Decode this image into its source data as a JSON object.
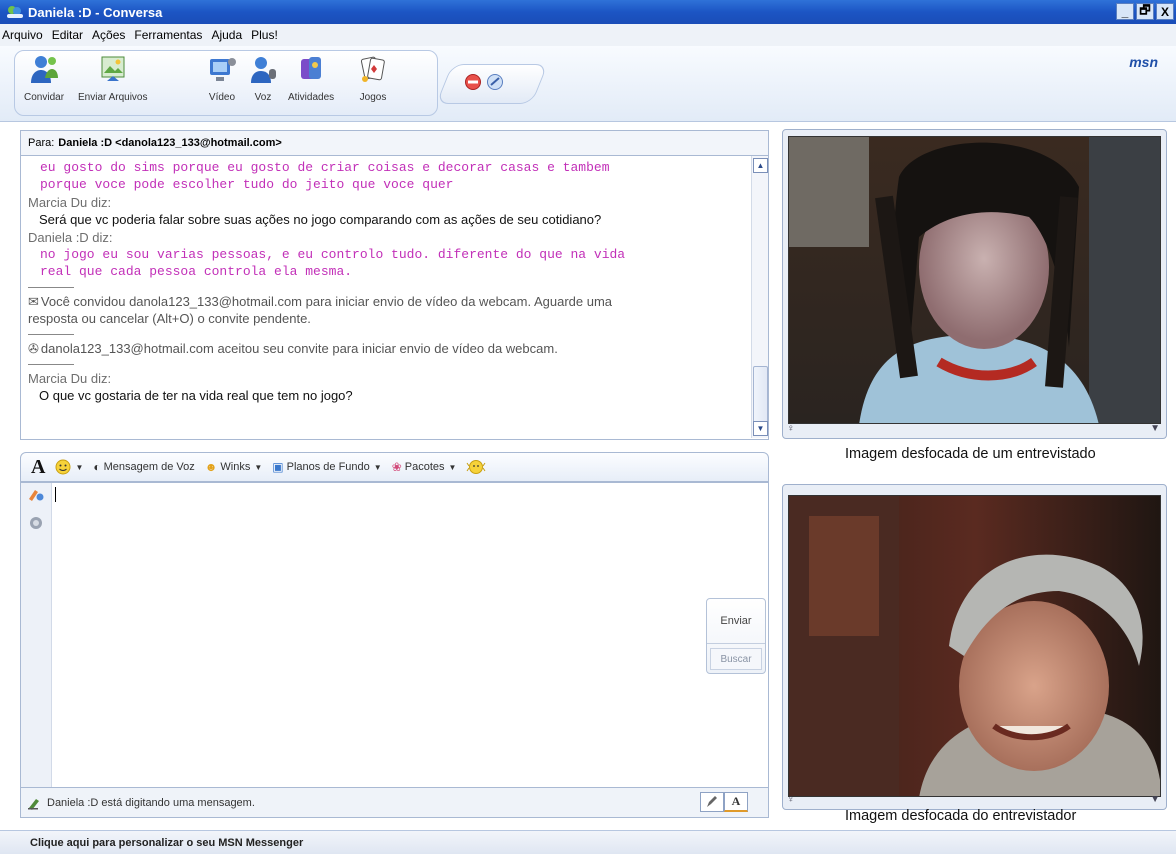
{
  "window": {
    "title": "Daniela :D - Conversa",
    "controls": [
      "_",
      "🗗",
      "X"
    ]
  },
  "menu": [
    "Arquivo",
    "Editar",
    "Ações",
    "Ferramentas",
    "Ajuda",
    "Plus!"
  ],
  "toolbar": {
    "buttons": [
      {
        "label": "Convidar",
        "icon": "invite-contact-icon"
      },
      {
        "label": "Enviar Arquivos",
        "icon": "send-files-icon"
      },
      {
        "label": "Vídeo",
        "icon": "video-camera-icon"
      },
      {
        "label": "Voz",
        "icon": "voice-icon"
      },
      {
        "label": "Atividades",
        "icon": "activities-icon"
      },
      {
        "label": "Jogos",
        "icon": "games-icon"
      }
    ],
    "extra_icons": [
      "block-icon",
      "display-picture-icon"
    ],
    "brand": "msn"
  },
  "conversation": {
    "to_label": "Para:",
    "to_contact": "Daniela :D <danola123_133@hotmail.com>",
    "messages": {
      "m1_line1": "eu gosto do sims porque eu gosto de criar coisas e decorar casas e tambem",
      "m1_line2": "porque voce pode escolher tudo do jeito que voce quer",
      "m2_speaker": "Marcia Du diz:",
      "m2_text": "Será que vc poderia falar sobre suas ações no jogo comparando com as ações de seu cotidiano?",
      "m3_speaker": "Daniela :D diz:",
      "m3_line1": "no jogo eu sou varias pessoas, e eu controlo tudo. diferente do que na vida",
      "m3_line2": "real que cada pessoa controla ela mesma.",
      "sys1_line1": "Você convidou danola123_133@hotmail.com para iniciar envio de vídeo da webcam. Aguarde uma",
      "sys1_line2": "resposta ou cancelar (Alt+O) o convite pendente.",
      "sys2": "danola123_133@hotmail.com aceitou seu convite para iniciar envio de vídeo da webcam.",
      "m4_speaker": "Marcia Du diz:",
      "m4_text": "O que vc gostaria de ter na vida real que tem no jogo?"
    }
  },
  "input_toolbar": {
    "font": "A",
    "voice": "Mensagem de Voz",
    "winks": "Winks",
    "backgrounds": "Planos de Fundo",
    "packs": "Pacotes"
  },
  "input": {
    "send_label": "Enviar",
    "search_label": "Buscar"
  },
  "status": {
    "typing": "Daniela :D está digitando uma mensagem."
  },
  "videos": {
    "caption_top": "Imagem desfocada  de um entrevistado",
    "caption_bottom": "Imagem desfocada  do entrevistador"
  },
  "bottom_bar": "Clique aqui para personalizar o seu MSN Messenger",
  "colors": {
    "titlebar": "#1c55c4",
    "incoming_text": "#c230b8",
    "panel_border": "#a9b9d3"
  }
}
